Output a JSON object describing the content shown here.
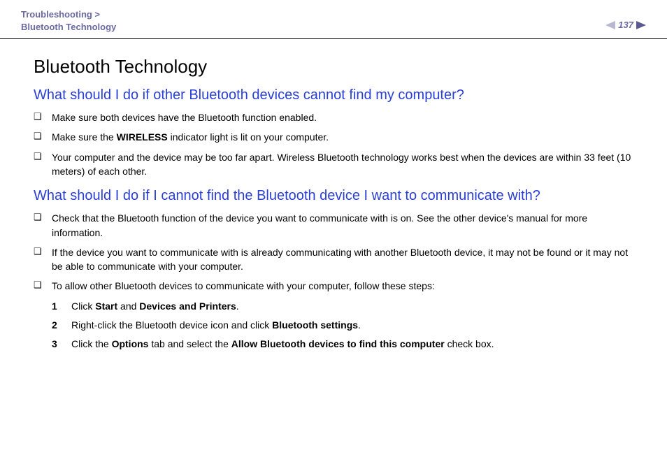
{
  "header": {
    "breadcrumb_line1": "Troubleshooting >",
    "breadcrumb_line2": "Bluetooth Technology",
    "page_number": "137"
  },
  "title": "Bluetooth Technology",
  "sections": [
    {
      "heading": "What should I do if other Bluetooth devices cannot find my computer?",
      "bullets": [
        {
          "pre": "Make sure both devices have the Bluetooth function enabled."
        },
        {
          "pre": "Make sure the ",
          "bold1": "WIRELESS",
          "post": " indicator light is lit on your computer."
        },
        {
          "pre": "Your computer and the device may be too far apart. Wireless Bluetooth technology works best when the devices are within 33 feet (10 meters) of each other."
        }
      ]
    },
    {
      "heading": "What should I do if I cannot find the Bluetooth device I want to communicate with?",
      "bullets": [
        {
          "pre": "Check that the Bluetooth function of the device you want to communicate with is on. See the other device's manual for more information."
        },
        {
          "pre": "If the device you want to communicate with is already communicating with another Bluetooth device, it may not be found or it may not be able to communicate with your computer."
        },
        {
          "pre": "To allow other Bluetooth devices to communicate with your computer, follow these steps:"
        }
      ],
      "steps": [
        {
          "n": "1",
          "pre": "Click ",
          "b1": "Start",
          "mid": " and ",
          "b2": "Devices and Printers",
          "post": "."
        },
        {
          "n": "2",
          "pre": "Right-click the Bluetooth device icon and click ",
          "b1": "Bluetooth settings",
          "post": "."
        },
        {
          "n": "3",
          "pre": "Click the ",
          "b1": "Options",
          "mid": " tab and select the ",
          "b2": "Allow Bluetooth devices to find this computer",
          "post": " check box."
        }
      ]
    }
  ]
}
